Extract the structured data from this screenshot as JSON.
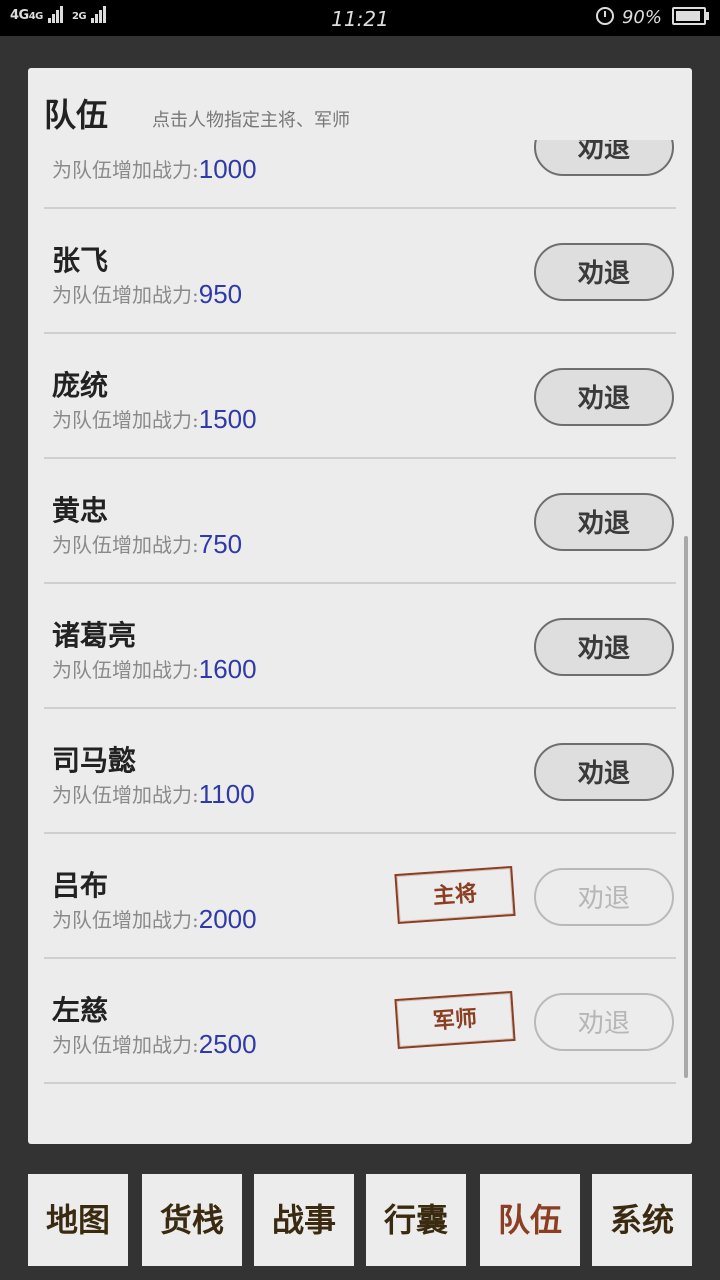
{
  "status_bar": {
    "network_left": "4G",
    "network_mid": "4G",
    "network_right": "2G",
    "time": "11:21",
    "battery_percent": "90%"
  },
  "panel": {
    "title": "队伍",
    "hint": "点击人物指定主将、军师",
    "power_label": "为队伍增加战力:",
    "dismiss_label": "劝退",
    "members": [
      {
        "name": "",
        "power": "1000",
        "stamp": "",
        "dismiss_enabled": true
      },
      {
        "name": "张飞",
        "power": "950",
        "stamp": "",
        "dismiss_enabled": true
      },
      {
        "name": "庞统",
        "power": "1500",
        "stamp": "",
        "dismiss_enabled": true
      },
      {
        "name": "黄忠",
        "power": "750",
        "stamp": "",
        "dismiss_enabled": true
      },
      {
        "name": "诸葛亮",
        "power": "1600",
        "stamp": "",
        "dismiss_enabled": true
      },
      {
        "name": "司马懿",
        "power": "1100",
        "stamp": "",
        "dismiss_enabled": true
      },
      {
        "name": "吕布",
        "power": "2000",
        "stamp": "主将",
        "dismiss_enabled": false
      },
      {
        "name": "左慈",
        "power": "2500",
        "stamp": "军师",
        "dismiss_enabled": false
      }
    ]
  },
  "nav": {
    "items": [
      {
        "label": "地图",
        "active": false
      },
      {
        "label": "货栈",
        "active": false
      },
      {
        "label": "战事",
        "active": false
      },
      {
        "label": "行囊",
        "active": false
      },
      {
        "label": "队伍",
        "active": true
      },
      {
        "label": "系统",
        "active": false
      }
    ]
  },
  "colors": {
    "stamp": "#8b3e22",
    "power_value": "#2e3aa8",
    "nav_active": "#8b3e22"
  }
}
